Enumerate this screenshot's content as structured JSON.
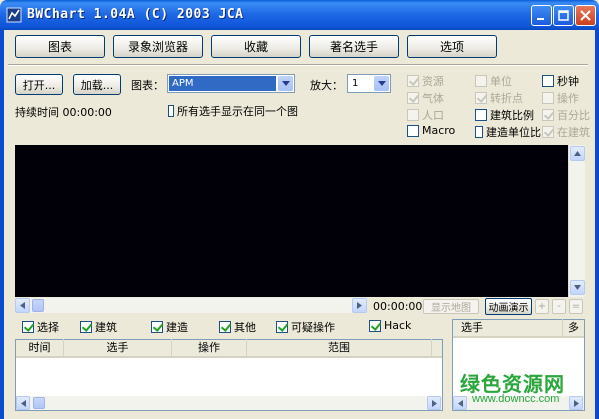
{
  "window": {
    "title": "BWChart 1.04A (C) 2003 JCA"
  },
  "toolbar": {
    "buttons": [
      "图表",
      "录象浏览器",
      "收藏",
      "著名选手",
      "选项"
    ]
  },
  "controls": {
    "open_label": "打开...",
    "load_label": "加载...",
    "chart_label": "图表：",
    "chart_value": "APM",
    "zoom_label": "放大：",
    "zoom_value": "1",
    "duration_label": "持续时间 00:00:00",
    "same_chart_label": "所有选手显示在同一个图"
  },
  "options": {
    "col1": [
      {
        "label": "资源",
        "checked": true,
        "enabled": false
      },
      {
        "label": "气体",
        "checked": true,
        "enabled": false
      },
      {
        "label": "人口",
        "checked": false,
        "enabled": false
      },
      {
        "label": "Macro",
        "checked": false,
        "enabled": true
      }
    ],
    "col2": [
      {
        "label": "单位",
        "checked": false,
        "enabled": false
      },
      {
        "label": "转折点",
        "checked": true,
        "enabled": false
      },
      {
        "label": "建筑比例",
        "checked": false,
        "enabled": true
      },
      {
        "label": "建造单位比",
        "checked": false,
        "enabled": true
      }
    ],
    "col3": [
      {
        "label": "秒钟",
        "checked": false,
        "enabled": true
      },
      {
        "label": "操作",
        "checked": false,
        "enabled": false
      },
      {
        "label": "百分比",
        "checked": true,
        "enabled": false
      },
      {
        "label": "在建筑",
        "checked": true,
        "enabled": false
      }
    ]
  },
  "playback": {
    "time": "00:00:00",
    "show_map_label": "显示地图",
    "animate_label": "动画演示",
    "plus_label": "+",
    "minus_label": "-",
    "equal_label": "="
  },
  "filters": [
    {
      "label": "选择",
      "checked": true
    },
    {
      "label": "建筑",
      "checked": true
    },
    {
      "label": "建造",
      "checked": true
    },
    {
      "label": "其他",
      "checked": true
    },
    {
      "label": "可疑操作",
      "checked": true
    },
    {
      "label": "Hack",
      "checked": true
    }
  ],
  "event_list": {
    "columns": [
      "时间",
      "选手",
      "操作",
      "范围"
    ]
  },
  "player_list": {
    "columns": [
      "选手",
      "多"
    ]
  },
  "watermark": {
    "main": "绿色资源网",
    "url": "www.downcc.com"
  },
  "colors": {
    "titlebar": "#0a5fd8",
    "view_bg": "#010008",
    "watermark": "#2aa63b"
  }
}
